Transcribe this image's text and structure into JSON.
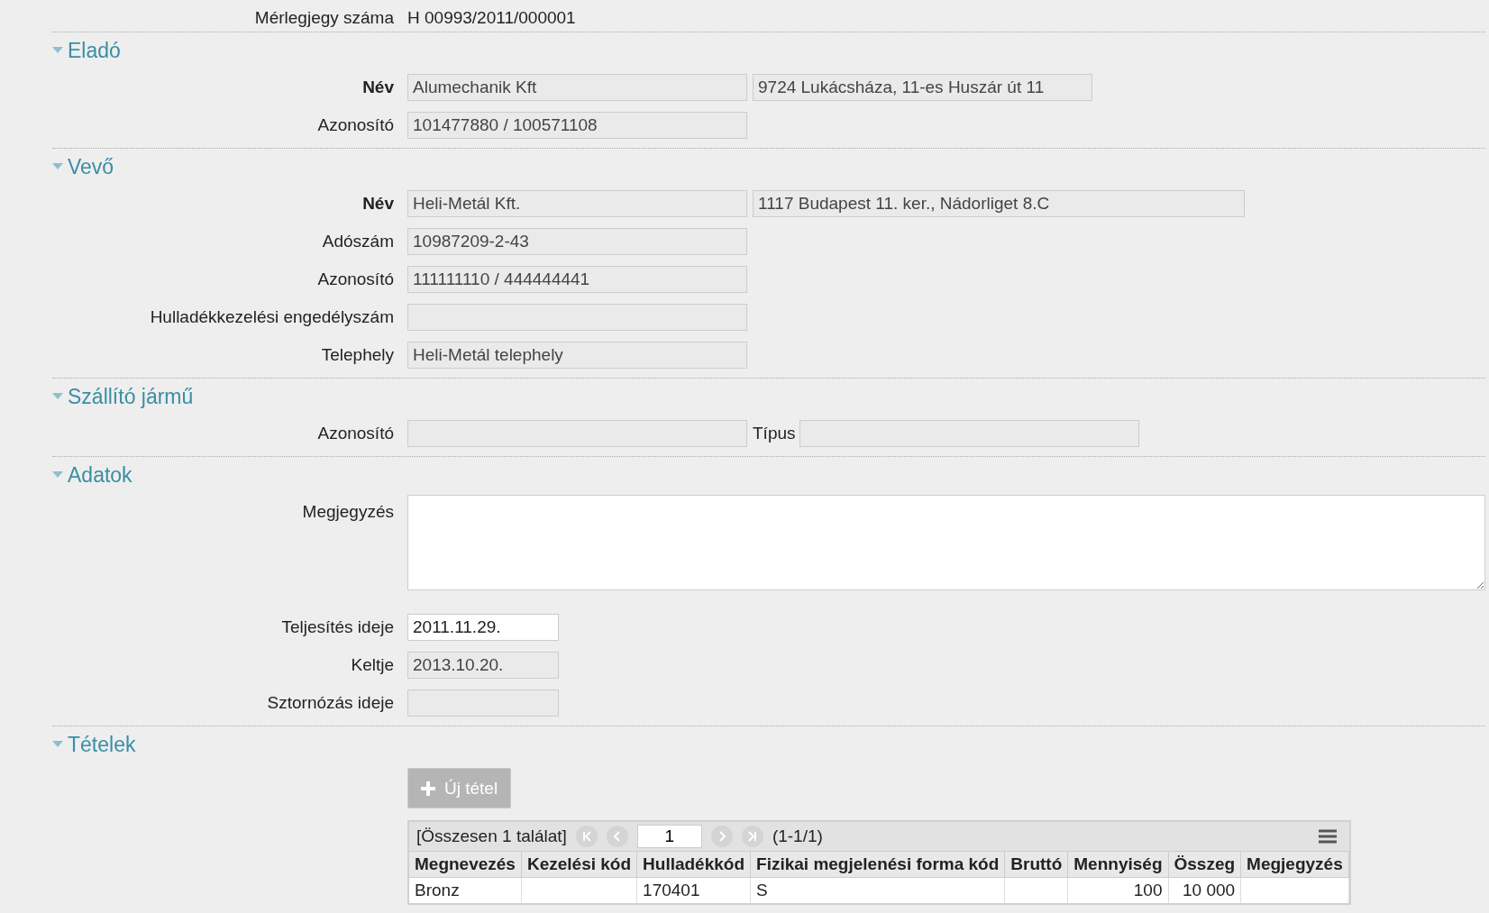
{
  "ticket": {
    "label": "Mérlegjegy száma",
    "value": "H 00993/2011/000001"
  },
  "sections": [
    {
      "title": "Eladó",
      "expanded": true,
      "rows": [
        {
          "label": "Név",
          "bold": true,
          "fields": [
            {
              "kind": "text",
              "disabled": true,
              "value": "Alumechanik Kft"
            },
            {
              "kind": "text",
              "disabled": true,
              "value": "9724 Lukácsháza, 11-es Huszár út 11"
            }
          ]
        },
        {
          "label": "Azonosító",
          "bold": false,
          "fields": [
            {
              "kind": "text",
              "disabled": true,
              "value": "101477880 / 100571108"
            }
          ]
        }
      ]
    },
    {
      "title": "Vevő",
      "expanded": true,
      "rows": [
        {
          "label": "Név",
          "bold": true,
          "fields": [
            {
              "kind": "text",
              "disabled": true,
              "value": "Heli-Metál Kft."
            },
            {
              "kind": "wide",
              "disabled": true,
              "value": "1117 Budapest 11. ker., Nádorliget 8.C"
            }
          ]
        },
        {
          "label": "Adószám",
          "bold": false,
          "fields": [
            {
              "kind": "text",
              "disabled": true,
              "value": "10987209-2-43"
            }
          ]
        },
        {
          "label": "Azonosító",
          "bold": false,
          "fields": [
            {
              "kind": "text",
              "disabled": true,
              "value": "111111110 / 444444441"
            }
          ]
        },
        {
          "label": "Hulladékkezelési engedélyszám",
          "bold": false,
          "fields": [
            {
              "kind": "text",
              "disabled": true
            }
          ]
        },
        {
          "label": "Telephely",
          "bold": false,
          "fields": [
            {
              "kind": "text",
              "disabled": true,
              "value": "Heli-Metál telephely"
            }
          ]
        }
      ]
    },
    {
      "title": "Szállító jármű",
      "expanded": true,
      "rows": [
        {
          "label": "Azonosító",
          "bold": false,
          "fields": [
            {
              "kind": "text",
              "disabled": true
            },
            {
              "kind": "text",
              "disabled": true,
              "label": "Típus"
            }
          ]
        }
      ]
    },
    {
      "title": "Adatok",
      "expanded": true,
      "rows": [
        {
          "label": "Megjegyzés",
          "bold": false,
          "fields": [
            {
              "kind": "textarea",
              "disabled": false
            }
          ]
        },
        {
          "label": "Teljesítés ideje",
          "bold": false,
          "fields": [
            {
              "kind": "short",
              "disabled": false,
              "value": "2011.11.29."
            }
          ]
        },
        {
          "label": "Keltje",
          "bold": false,
          "fields": [
            {
              "kind": "short",
              "disabled": true,
              "value": "2013.10.20."
            }
          ]
        },
        {
          "label": "Sztornózás ideje",
          "bold": false,
          "fields": [
            {
              "kind": "short",
              "disabled": true
            }
          ]
        }
      ]
    },
    {
      "title": "Tételek",
      "expanded": true
    }
  ],
  "items": {
    "new_button": {
      "label": "Új tétel",
      "disabled": true
    },
    "pager": {
      "summary": "[Összesen 1 találat]",
      "page": "1",
      "range": "(1-1/1)"
    },
    "columns": [
      {
        "label": "Megnevezés",
        "kind": "text"
      },
      {
        "label": "Kezelési kód",
        "kind": "text"
      },
      {
        "label": "Hulladékkód",
        "kind": "text"
      },
      {
        "label": "Fizikai megjelenési forma kód",
        "kind": "text"
      },
      {
        "label": "Bruttó",
        "kind": "number"
      },
      {
        "label": "Mennyiség",
        "kind": "number"
      },
      {
        "label": "Összeg",
        "kind": "number"
      },
      {
        "label": "Megjegyzés",
        "kind": "text"
      }
    ],
    "rows": [
      [
        "Bronz",
        "",
        "170401",
        "S",
        "",
        "100",
        "10 000",
        ""
      ]
    ]
  }
}
